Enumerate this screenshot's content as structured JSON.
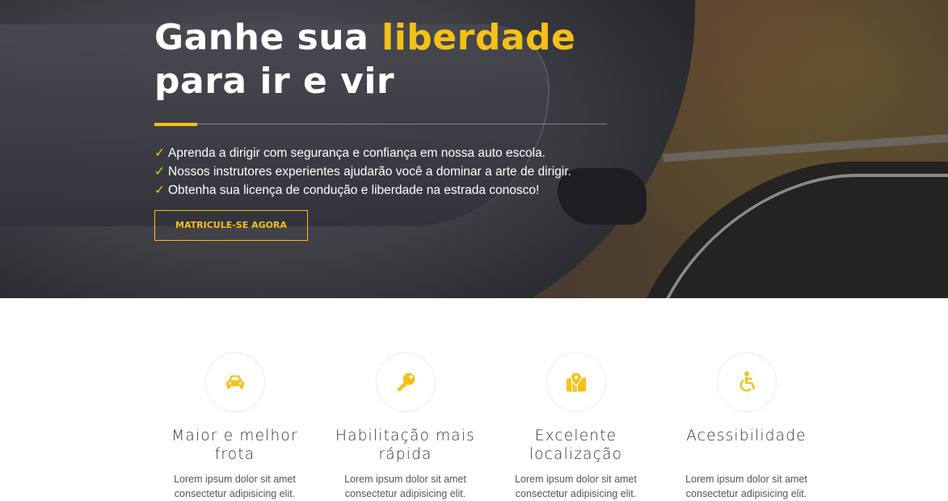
{
  "hero": {
    "title_part1": "Ganhe sua ",
    "title_accent": "liberdade",
    "title_part2": "para ir e vir",
    "bullets": [
      "Aprenda a dirigir com segurança e confiança em nossa auto escola.",
      "Nossos instrutores experientes ajudarão você a dominar a arte de dirigir.",
      "Obtenha sua licença de condução e liberdade na estrada conosco!"
    ],
    "bullet_marker": "✓",
    "cta_label": "MATRICULE-SE AGORA"
  },
  "features": [
    {
      "icon": "car-icon",
      "title": "Maior e melhor frota",
      "text": "Lorem ipsum dolor sit amet consectetur adipisicing elit."
    },
    {
      "icon": "key-icon",
      "title": "Habilitação mais rápida",
      "text": "Lorem ipsum dolor sit amet consectetur adipisicing elit."
    },
    {
      "icon": "map-marker-icon",
      "title": "Excelente localização",
      "text": "Lorem ipsum dolor sit amet consectetur adipisicing elit."
    },
    {
      "icon": "accessibility-icon",
      "title": "Acessibilidade",
      "text": "Lorem ipsum dolor sit amet consectetur adipisicing elit."
    }
  ],
  "colors": {
    "accent": "#f7c018",
    "text_dark": "#333333",
    "text_muted": "#555555"
  }
}
